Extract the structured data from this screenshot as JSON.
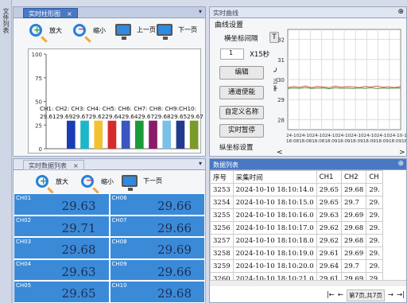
{
  "sidebar": {
    "label": "文件列表"
  },
  "bar_panel": {
    "tab": "实时柱形图",
    "close": "×",
    "zoom_in": "放大",
    "zoom_out": "缩小",
    "prev": "上一页",
    "next": "下一页",
    "legend_line1": "CH1: CH2: CH3: CH4: CH5: CH6: CH7: CH8: CH9:CH10:",
    "legend_line2": "29.6129.6929.6729.6229.6429.6429.6729.6829.6529.67"
  },
  "chart_data": [
    {
      "type": "bar",
      "categories": [
        "CH1",
        "CH2",
        "CH3",
        "CH4",
        "CH5",
        "CH6",
        "CH7",
        "CH8",
        "CH9",
        "CH10"
      ],
      "values": [
        29.61,
        29.69,
        29.67,
        29.62,
        29.64,
        29.64,
        29.67,
        29.68,
        29.65,
        29.67
      ],
      "ylim": [
        0,
        100
      ],
      "yticks": [
        "100",
        "75",
        "50",
        "25",
        "0"
      ],
      "colors": [
        "#1a3db5",
        "#1fb5c8",
        "#f2c233",
        "#d62b2b",
        "#3a56c0",
        "#1c9a3a",
        "#8b1b6a",
        "#7cc0e8",
        "#233a8c",
        "#7a9a2a"
      ]
    },
    {
      "type": "line",
      "yticks": [
        "32",
        "31",
        "30",
        "29",
        "28"
      ],
      "ylim": [
        27.5,
        32.5
      ],
      "ylabel": "单位 ℃",
      "series": [
        {
          "color": "#c86b4a",
          "values": [
            29.6,
            29.65,
            29.62,
            29.68,
            29.6,
            29.66,
            29.63,
            29.6,
            29.67,
            29.62,
            29.65,
            29.64,
            29.6,
            29.66,
            29.63,
            29.68,
            29.62,
            29.64,
            29.6,
            29.65
          ]
        },
        {
          "color": "#5a8a3a",
          "values": [
            29.55,
            29.58,
            29.56,
            29.6,
            29.55,
            29.57,
            29.58,
            29.54,
            29.59,
            29.56,
            29.57,
            29.55,
            29.58,
            29.56,
            29.59,
            29.55,
            29.57,
            29.56,
            29.58,
            29.57
          ]
        }
      ],
      "xlabels_line1": "24-1024-1024-1024-1024-1024-1024-1024-1024-10-10",
      "xlabels_line2": "18:0818:0818:0818:0918:0918:0918:0918:0918:0918:10:17"
    }
  ],
  "curve_panel": {
    "tab": "实时曲线",
    "pin": "⊕",
    "group": "曲线设置",
    "interval_label": "横坐标间隔",
    "interval_btn": "T",
    "spin_value": "1",
    "unit": "X15秒",
    "edit": "编辑",
    "channel": "通道使能",
    "custom": "自定义名称",
    "pause": "实时暂停",
    "ylabel_setting": "纵坐标设置",
    "scroll_left": "<",
    "scroll_right": ">"
  },
  "data_panel": {
    "tab": "实时数据列表",
    "close": "×",
    "zoom_in": "放大",
    "zoom_out": "缩小",
    "page": "下一页"
  },
  "cells": [
    {
      "label": "CH01",
      "value": "29.63"
    },
    {
      "label": "CH06",
      "value": "29.66"
    },
    {
      "label": "CH02",
      "value": "29.71"
    },
    {
      "label": "CH07",
      "value": "29.66"
    },
    {
      "label": "CH03",
      "value": "29.68"
    },
    {
      "label": "CH08",
      "value": "29.69"
    },
    {
      "label": "CH04",
      "value": "29.63"
    },
    {
      "label": "CH09",
      "value": "29.66"
    },
    {
      "label": "CH05",
      "value": "29.65"
    },
    {
      "label": "CH10",
      "value": "29.68"
    }
  ],
  "list_panel": {
    "tab": "数据列表",
    "pin": "⊕",
    "columns": [
      "序号",
      "采集时间",
      "CH1",
      "CH2",
      "CH"
    ],
    "rows": [
      [
        "3253",
        "2024-10-10 18:10:14.0",
        "29.65",
        "29.68",
        "29."
      ],
      [
        "3254",
        "2024-10-10 18:10:15.0",
        "29.65",
        "29.7",
        "29."
      ],
      [
        "3255",
        "2024-10-10 18:10:16.0",
        "29.63",
        "29.69",
        "29."
      ],
      [
        "3256",
        "2024-10-10 18:10:17.0",
        "29.62",
        "29.68",
        "29."
      ],
      [
        "3257",
        "2024-10-10 18:10:18.0",
        "29.62",
        "29.68",
        "29."
      ],
      [
        "3258",
        "2024-10-10 18:10:19.0",
        "29.61",
        "29.69",
        "29."
      ],
      [
        "3259",
        "2024-10-10 18:10:20.0",
        "29.64",
        "29.7",
        "29."
      ],
      [
        "3260",
        "2024-10-10 18:10:21.0",
        "29.61",
        "29.69",
        "29."
      ]
    ],
    "pager_first": "|←",
    "pager_prev": "←",
    "pager_info": "第7页,共7页",
    "pager_next": "→",
    "pager_last": "→|"
  }
}
